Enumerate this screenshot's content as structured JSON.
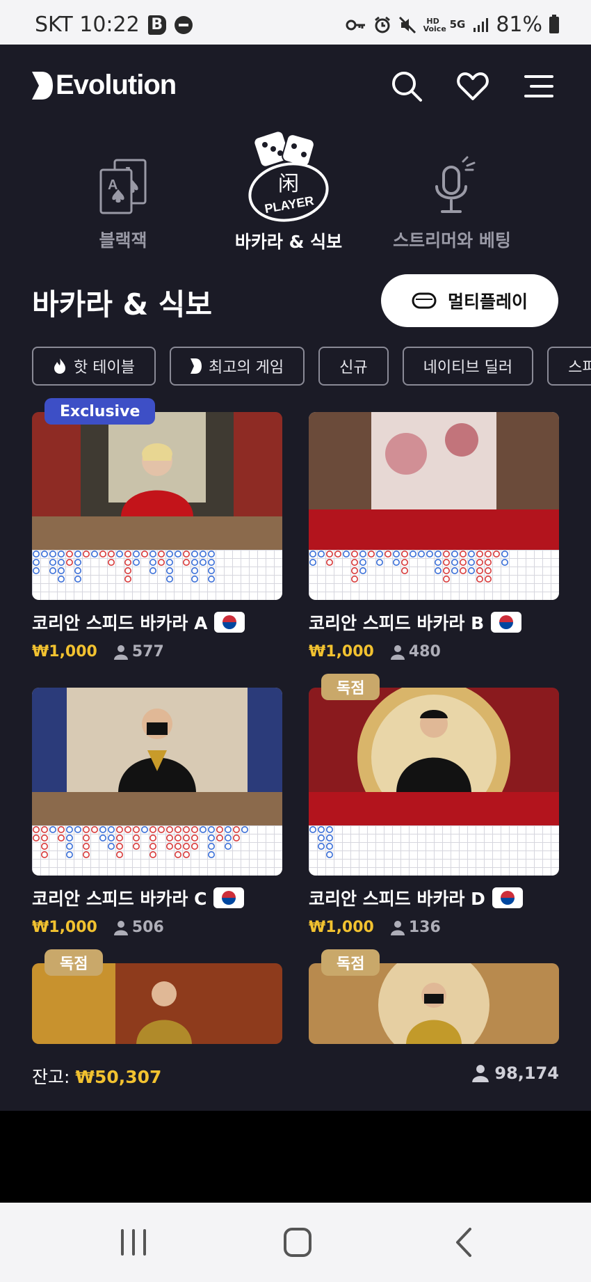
{
  "status_bar": {
    "carrier_time": "SKT 10:22",
    "b_icon_letter": "B",
    "hd_voice": "HD Voice",
    "network": "5G",
    "battery": "81%"
  },
  "header": {
    "brand": "Evolution"
  },
  "categories": [
    {
      "label": "블랙잭"
    },
    {
      "label": "바카라 & 식보",
      "icon_text_top": "闲",
      "icon_text_bottom": "PLAYER"
    },
    {
      "label": "스트리머와 베팅"
    }
  ],
  "section": {
    "title": "바카라 & 식보",
    "multiplay_label": "멀티플레이"
  },
  "chips": [
    "핫 테이블",
    "최고의 게임",
    "신규",
    "네이티브 딜러",
    "스피"
  ],
  "cards": [
    {
      "title": "코리안 스피드 바카라 A",
      "price": "₩1,000",
      "players": "577",
      "badge": "Exclusive"
    },
    {
      "title": "코리안 스피드 바카라 B",
      "price": "₩1,000",
      "players": "480"
    },
    {
      "title": "코리안 스피드 바카라 C",
      "price": "₩1,000",
      "players": "506"
    },
    {
      "title": "코리안 스피드 바카라 D",
      "price": "₩1,000",
      "players": "136",
      "badge": "독점"
    },
    {
      "badge": "독점"
    },
    {
      "badge": "독점"
    }
  ],
  "footer": {
    "balance_label": "잔고:",
    "balance_value": "₩50,307",
    "online_count": "98,174"
  },
  "colors": {
    "background": "#1b1b26",
    "price": "#f2c230",
    "exclusive_badge": "#3d4fc6",
    "dokjeom_badge": "#c9a86a"
  }
}
